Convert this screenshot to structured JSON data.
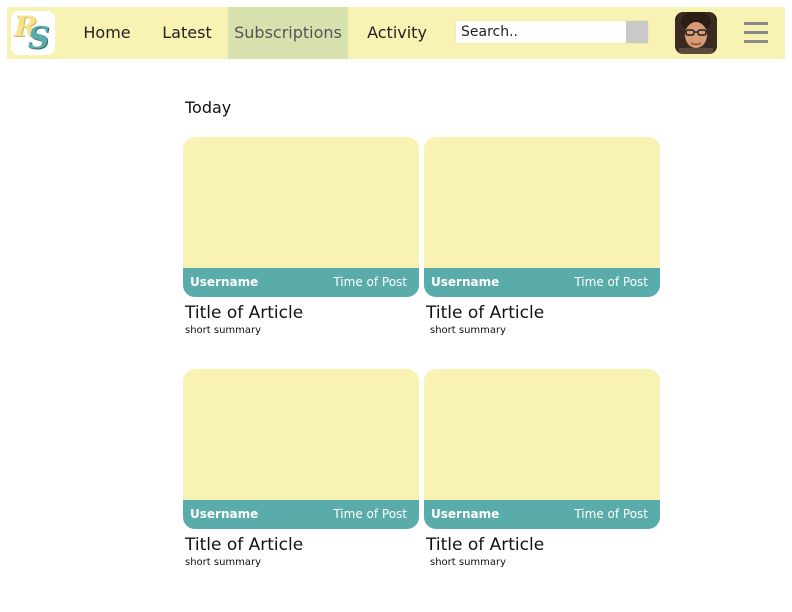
{
  "header": {
    "logo_letters": [
      "R",
      "S"
    ],
    "nav": [
      {
        "label": "Home",
        "active": false
      },
      {
        "label": "Latest",
        "active": false
      },
      {
        "label": "Subscriptions",
        "active": true
      },
      {
        "label": "Activity",
        "active": false
      }
    ],
    "search": {
      "placeholder": "Search..",
      "value": ""
    },
    "avatar_icon": "user-avatar",
    "menu_icon": "hamburger-menu"
  },
  "main": {
    "section_title": "Today",
    "cards": [
      {
        "username": "Username",
        "time": "Time of Post",
        "title": "Title of Article",
        "summary": "short summary"
      },
      {
        "username": "Username",
        "time": "Time of Post",
        "title": "Title of Article",
        "summary": "short summary"
      },
      {
        "username": "Username",
        "time": "Time of Post",
        "title": "Title of Article",
        "summary": "short summary"
      },
      {
        "username": "Username",
        "time": "Time of Post",
        "title": "Title of Article",
        "summary": "short summary"
      }
    ]
  },
  "colors": {
    "header_bg": "#f8f3b2",
    "nav_active_bg": "#d6e1ad",
    "card_thumb_bg": "#f8f3b2",
    "card_meta_bg": "#5aacaa"
  }
}
